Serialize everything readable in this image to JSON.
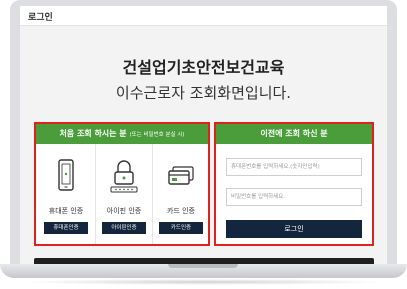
{
  "header": {
    "title": "로그인"
  },
  "main": {
    "title": "건설업기초안전보건교육",
    "subtitle": "이수근로자 조회화면입니다."
  },
  "first_time": {
    "heading": "처음 조회 하시는 분",
    "heading_note": "(또는 비밀번호 분실 시)",
    "methods": [
      {
        "label": "휴대폰 인증",
        "button": "휴대폰인증",
        "icon": "mobile-phone-icon"
      },
      {
        "label": "아이핀 인증",
        "button": "아이핀인증",
        "icon": "ipin-lock-icon"
      },
      {
        "label": "카드 인증",
        "button": "카드인증",
        "icon": "credit-card-icon"
      }
    ]
  },
  "returning": {
    "heading": "이전에 조회 하신 분",
    "phone_placeholder": "휴대폰번호를 입력하세요.(숫자만입력)",
    "password_placeholder": "비밀번호를 입력하세요.",
    "login_label": "로그인"
  },
  "colors": {
    "header_green": "#4a9d3a",
    "button_navy": "#13263d",
    "highlight_red": "#e0221f"
  }
}
